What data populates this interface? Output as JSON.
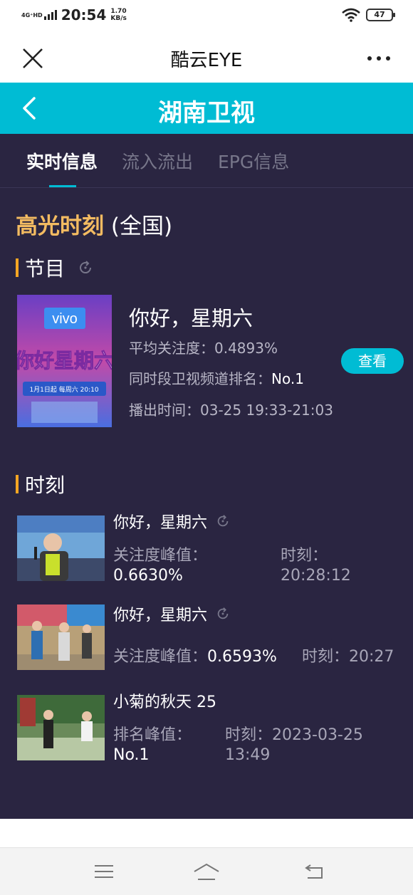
{
  "status_bar": {
    "network": "4G⁺HD",
    "time": "20:54",
    "speed_value": "1.70",
    "speed_unit": "KB/s",
    "battery": "47"
  },
  "app_bar": {
    "title": "酷云EYE"
  },
  "channel": {
    "title": "湖南卫视"
  },
  "tabs": [
    {
      "label": "实时信息",
      "active": true
    },
    {
      "label": "流入流出",
      "active": false
    },
    {
      "label": "EPG信息",
      "active": false
    }
  ],
  "highlight": {
    "title": "高光时刻",
    "scope": " (全国)"
  },
  "program_section": {
    "label": "节目",
    "program": {
      "name": "你好，星期六",
      "avg_attention_label": "平均关注度：",
      "avg_attention_value": "0.4893%",
      "rank_label": "同时段卫视频道排名：",
      "rank_value": "No.1",
      "airtime_label": "播出时间：",
      "airtime_value": "03-25 19:33-21:03",
      "view_button": "查看",
      "thumb_text": {
        "brand": "vivo",
        "date": "1月1日起 每周六 20:10"
      }
    }
  },
  "moments_section": {
    "label": "时刻",
    "items": [
      {
        "name": "你好，星期六",
        "peak_label": "关注度峰值：",
        "peak_value": "0.6630%",
        "time_label": "时刻：",
        "time_value": "20:28:12"
      },
      {
        "name": "你好，星期六",
        "peak_label": "关注度峰值：",
        "peak_value": "0.6593%",
        "time_label": "时刻：",
        "time_value": "20:27"
      },
      {
        "name": "小菊的秋天 25",
        "peak_label": "排名峰值：",
        "peak_value": "No.1",
        "time_label": "时刻：",
        "time_value_line1": "2023-03-25",
        "time_value_line2": "13:49"
      }
    ]
  },
  "colors": {
    "accent": "#00bcd4",
    "background": "#2a2541",
    "highlight": "#f3bb61",
    "section_bar": "#f5a623"
  }
}
